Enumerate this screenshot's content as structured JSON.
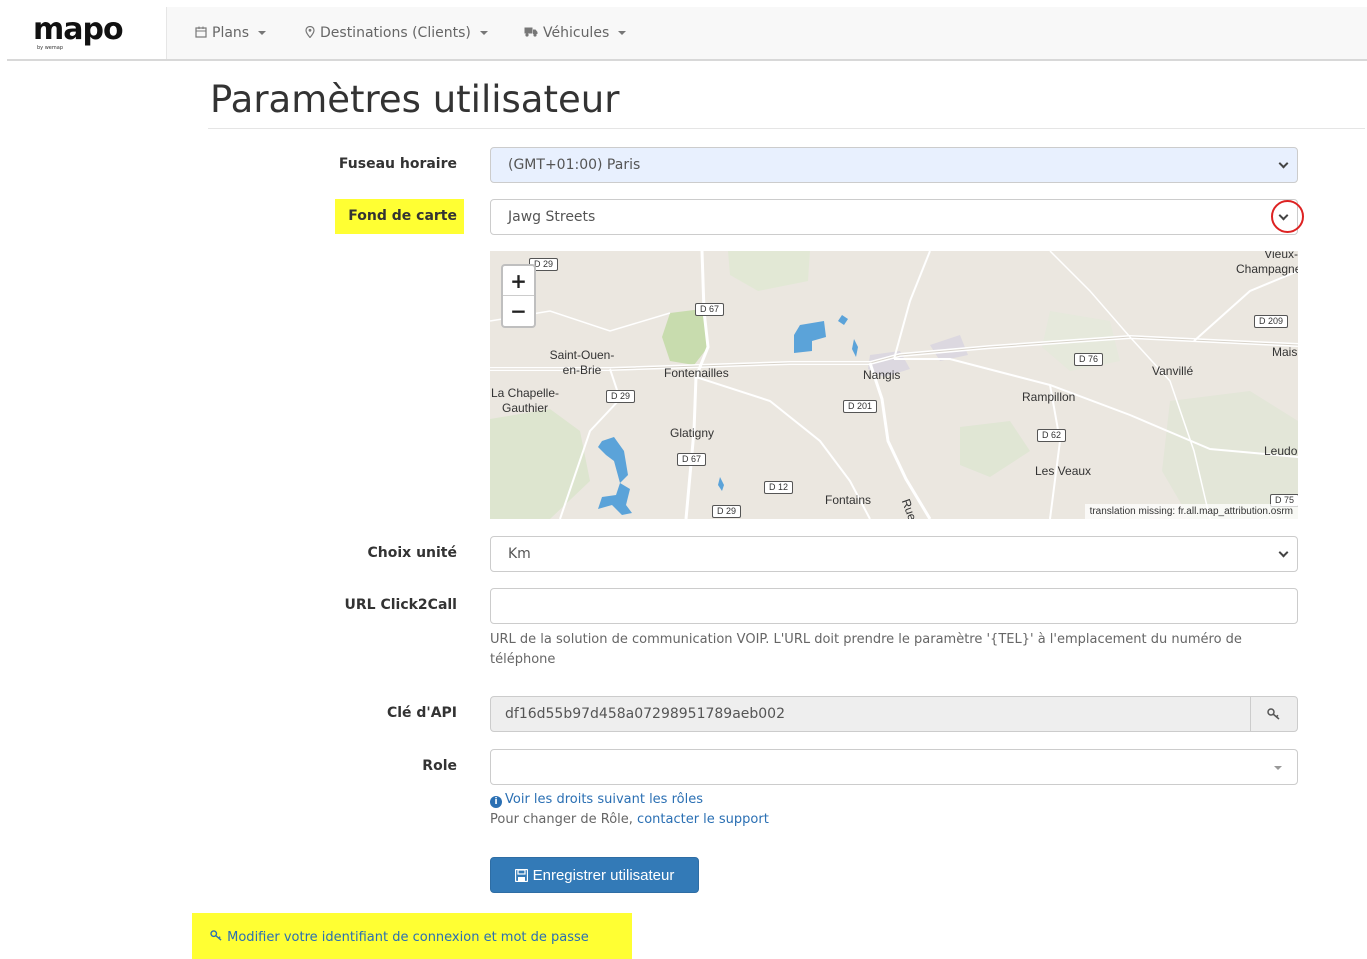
{
  "navbar": {
    "logo": "mapo",
    "logo_sub": "by wemap",
    "items": [
      {
        "icon": "calendar-icon",
        "label": "Plans"
      },
      {
        "icon": "map-marker-icon",
        "label": "Destinations (Clients)"
      },
      {
        "icon": "truck-icon",
        "label": "Véhicules"
      }
    ]
  },
  "page": {
    "title": "Paramètres utilisateur"
  },
  "form": {
    "timezone": {
      "label": "Fuseau horaire",
      "value": "(GMT+01:00) Paris"
    },
    "basemap": {
      "label": "Fond de carte",
      "value": "Jawg Streets"
    },
    "unit": {
      "label": "Choix unité",
      "value": "Km"
    },
    "click2call": {
      "label": "URL Click2Call",
      "value": "",
      "help": "URL de la solution de communication VOIP. L'URL doit prendre le paramètre '{TEL}' à l'emplacement du numéro de téléphone"
    },
    "api_key": {
      "label": "Clé d'API",
      "value": "df16d55b97d458a07298951789aeb002",
      "icon": "key-icon"
    },
    "role": {
      "label": "Role",
      "value": "",
      "link_rights": "Voir les droits suivant les rôles",
      "change_text": "Pour changer de Rôle,",
      "change_link": "contacter le support"
    },
    "save_button": "Enregistrer utilisateur",
    "modify_link": "Modifier votre identifiant de connexion et mot de passe"
  },
  "map": {
    "zoom_in": "+",
    "zoom_out": "−",
    "attribution": "translation missing: fr.all.map_attribution.osrm",
    "places": [
      "Vieux-Champagne",
      "Saint-Ouen-en-Brie",
      "Fontenailles",
      "Nangis",
      "Vanvillé",
      "Mais",
      "La Chapelle-Gauthier",
      "Rampillon",
      "Glatigny",
      "Leudo",
      "Les Veaux",
      "Fontains",
      "Rue d"
    ],
    "roads": [
      "D 29",
      "D 67",
      "D 209",
      "D 76",
      "D 29",
      "D 201",
      "D 62",
      "D 67",
      "D 12",
      "D 29",
      "D 75"
    ]
  },
  "colors": {
    "highlight": "#ffff33",
    "primary": "#337ab7",
    "link": "#2a6fb3",
    "red_circle": "#dd2222"
  }
}
